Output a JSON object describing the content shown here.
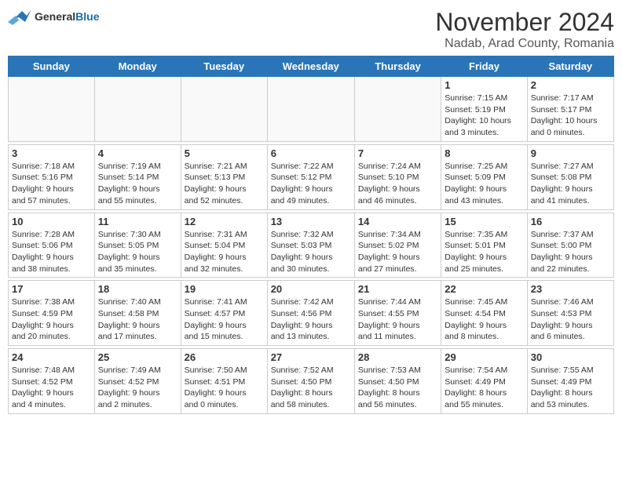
{
  "header": {
    "logo_general": "General",
    "logo_blue": "Blue",
    "month_title": "November 2024",
    "location": "Nadab, Arad County, Romania"
  },
  "weekdays": [
    "Sunday",
    "Monday",
    "Tuesday",
    "Wednesday",
    "Thursday",
    "Friday",
    "Saturday"
  ],
  "weeks": [
    [
      {
        "day": "",
        "info": ""
      },
      {
        "day": "",
        "info": ""
      },
      {
        "day": "",
        "info": ""
      },
      {
        "day": "",
        "info": ""
      },
      {
        "day": "",
        "info": ""
      },
      {
        "day": "1",
        "info": "Sunrise: 7:15 AM\nSunset: 5:19 PM\nDaylight: 10 hours\nand 3 minutes."
      },
      {
        "day": "2",
        "info": "Sunrise: 7:17 AM\nSunset: 5:17 PM\nDaylight: 10 hours\nand 0 minutes."
      }
    ],
    [
      {
        "day": "3",
        "info": "Sunrise: 7:18 AM\nSunset: 5:16 PM\nDaylight: 9 hours\nand 57 minutes."
      },
      {
        "day": "4",
        "info": "Sunrise: 7:19 AM\nSunset: 5:14 PM\nDaylight: 9 hours\nand 55 minutes."
      },
      {
        "day": "5",
        "info": "Sunrise: 7:21 AM\nSunset: 5:13 PM\nDaylight: 9 hours\nand 52 minutes."
      },
      {
        "day": "6",
        "info": "Sunrise: 7:22 AM\nSunset: 5:12 PM\nDaylight: 9 hours\nand 49 minutes."
      },
      {
        "day": "7",
        "info": "Sunrise: 7:24 AM\nSunset: 5:10 PM\nDaylight: 9 hours\nand 46 minutes."
      },
      {
        "day": "8",
        "info": "Sunrise: 7:25 AM\nSunset: 5:09 PM\nDaylight: 9 hours\nand 43 minutes."
      },
      {
        "day": "9",
        "info": "Sunrise: 7:27 AM\nSunset: 5:08 PM\nDaylight: 9 hours\nand 41 minutes."
      }
    ],
    [
      {
        "day": "10",
        "info": "Sunrise: 7:28 AM\nSunset: 5:06 PM\nDaylight: 9 hours\nand 38 minutes."
      },
      {
        "day": "11",
        "info": "Sunrise: 7:30 AM\nSunset: 5:05 PM\nDaylight: 9 hours\nand 35 minutes."
      },
      {
        "day": "12",
        "info": "Sunrise: 7:31 AM\nSunset: 5:04 PM\nDaylight: 9 hours\nand 32 minutes."
      },
      {
        "day": "13",
        "info": "Sunrise: 7:32 AM\nSunset: 5:03 PM\nDaylight: 9 hours\nand 30 minutes."
      },
      {
        "day": "14",
        "info": "Sunrise: 7:34 AM\nSunset: 5:02 PM\nDaylight: 9 hours\nand 27 minutes."
      },
      {
        "day": "15",
        "info": "Sunrise: 7:35 AM\nSunset: 5:01 PM\nDaylight: 9 hours\nand 25 minutes."
      },
      {
        "day": "16",
        "info": "Sunrise: 7:37 AM\nSunset: 5:00 PM\nDaylight: 9 hours\nand 22 minutes."
      }
    ],
    [
      {
        "day": "17",
        "info": "Sunrise: 7:38 AM\nSunset: 4:59 PM\nDaylight: 9 hours\nand 20 minutes."
      },
      {
        "day": "18",
        "info": "Sunrise: 7:40 AM\nSunset: 4:58 PM\nDaylight: 9 hours\nand 17 minutes."
      },
      {
        "day": "19",
        "info": "Sunrise: 7:41 AM\nSunset: 4:57 PM\nDaylight: 9 hours\nand 15 minutes."
      },
      {
        "day": "20",
        "info": "Sunrise: 7:42 AM\nSunset: 4:56 PM\nDaylight: 9 hours\nand 13 minutes."
      },
      {
        "day": "21",
        "info": "Sunrise: 7:44 AM\nSunset: 4:55 PM\nDaylight: 9 hours\nand 11 minutes."
      },
      {
        "day": "22",
        "info": "Sunrise: 7:45 AM\nSunset: 4:54 PM\nDaylight: 9 hours\nand 8 minutes."
      },
      {
        "day": "23",
        "info": "Sunrise: 7:46 AM\nSunset: 4:53 PM\nDaylight: 9 hours\nand 6 minutes."
      }
    ],
    [
      {
        "day": "24",
        "info": "Sunrise: 7:48 AM\nSunset: 4:52 PM\nDaylight: 9 hours\nand 4 minutes."
      },
      {
        "day": "25",
        "info": "Sunrise: 7:49 AM\nSunset: 4:52 PM\nDaylight: 9 hours\nand 2 minutes."
      },
      {
        "day": "26",
        "info": "Sunrise: 7:50 AM\nSunset: 4:51 PM\nDaylight: 9 hours\nand 0 minutes."
      },
      {
        "day": "27",
        "info": "Sunrise: 7:52 AM\nSunset: 4:50 PM\nDaylight: 8 hours\nand 58 minutes."
      },
      {
        "day": "28",
        "info": "Sunrise: 7:53 AM\nSunset: 4:50 PM\nDaylight: 8 hours\nand 56 minutes."
      },
      {
        "day": "29",
        "info": "Sunrise: 7:54 AM\nSunset: 4:49 PM\nDaylight: 8 hours\nand 55 minutes."
      },
      {
        "day": "30",
        "info": "Sunrise: 7:55 AM\nSunset: 4:49 PM\nDaylight: 8 hours\nand 53 minutes."
      }
    ]
  ]
}
